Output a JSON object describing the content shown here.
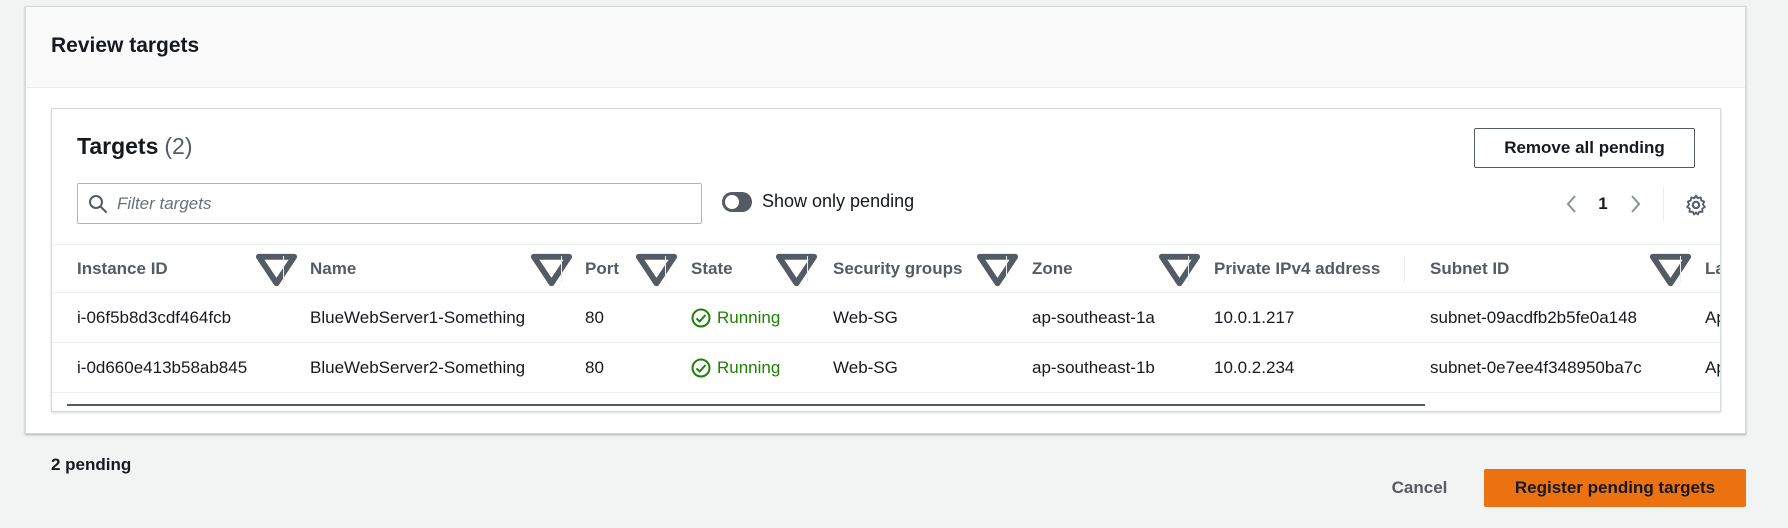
{
  "review": {
    "title": "Review targets"
  },
  "targets": {
    "title": "Targets",
    "count": "(2)",
    "remove_all_label": "Remove all pending",
    "filter_placeholder": "Filter targets",
    "toggle_label": "Show only pending",
    "toggle_on": false,
    "page": "1"
  },
  "table": {
    "columns": [
      {
        "label": "Instance ID",
        "sortable": true
      },
      {
        "label": "Name",
        "sortable": true
      },
      {
        "label": "Port",
        "sortable": true
      },
      {
        "label": "State",
        "sortable": true
      },
      {
        "label": "Security groups",
        "sortable": true
      },
      {
        "label": "Zone",
        "sortable": true
      },
      {
        "label": "Private IPv4 address",
        "sortable": false
      },
      {
        "label": "Subnet ID",
        "sortable": true
      },
      {
        "label": "La",
        "sortable": false
      }
    ],
    "rows": [
      {
        "instance_id": "i-06f5b8d3cdf464fcb",
        "name": "BlueWebServer1-Something",
        "port": "80",
        "state": "Running",
        "security_groups": "Web-SG",
        "zone": "ap-southeast-1a",
        "ipv4": "10.0.1.217",
        "subnet": "subnet-09acdfb2b5fe0a148",
        "launch": "Ap"
      },
      {
        "instance_id": "i-0d660e413b58ab845",
        "name": "BlueWebServer2-Something",
        "port": "80",
        "state": "Running",
        "security_groups": "Web-SG",
        "zone": "ap-southeast-1b",
        "ipv4": "10.0.2.234",
        "subnet": "subnet-0e7ee4f348950ba7c",
        "launch": "Ap"
      }
    ]
  },
  "footer": {
    "pending_text": "2 pending",
    "cancel_label": "Cancel",
    "register_label": "Register pending targets"
  },
  "colors": {
    "primary_button": "#ec7211",
    "running": "#1d8102",
    "background": "#f2f3f3"
  }
}
